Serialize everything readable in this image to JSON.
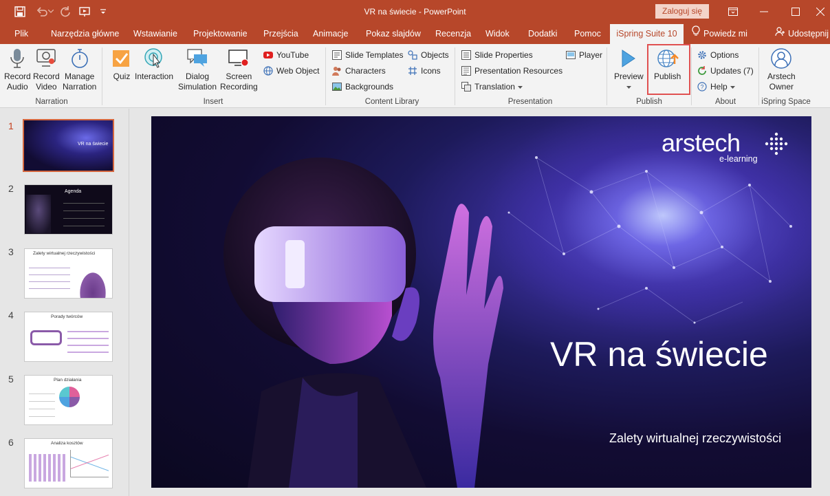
{
  "window": {
    "title": "VR na świecie  -  PowerPoint",
    "login_label": "Zaloguj się"
  },
  "tabs": [
    {
      "label": "Plik"
    },
    {
      "label": "Narzędzia główne"
    },
    {
      "label": "Wstawianie"
    },
    {
      "label": "Projektowanie"
    },
    {
      "label": "Przejścia"
    },
    {
      "label": "Animacje"
    },
    {
      "label": "Pokaz slajdów"
    },
    {
      "label": "Recenzja"
    },
    {
      "label": "Widok"
    },
    {
      "label": "Dodatki"
    },
    {
      "label": "Pomoc"
    },
    {
      "label": "iSpring Suite 10",
      "active": true
    }
  ],
  "tell_me": "Powiedz mi",
  "share": "Udostępnij",
  "ribbon": {
    "narration": {
      "group_label": "Narration",
      "record_audio": "Record\nAudio",
      "record_video": "Record\nVideo",
      "manage_narration": "Manage\nNarration"
    },
    "insert": {
      "group_label": "Insert",
      "quiz": "Quiz",
      "interaction": "Interaction",
      "dialog_simulation": "Dialog\nSimulation",
      "screen_recording": "Screen\nRecording",
      "youtube": "YouTube",
      "web_object": "Web Object"
    },
    "content_library": {
      "group_label": "Content Library",
      "slide_templates": "Slide Templates",
      "characters": "Characters",
      "backgrounds": "Backgrounds",
      "objects": "Objects",
      "icons": "Icons"
    },
    "presentation": {
      "group_label": "Presentation",
      "slide_properties": "Slide Properties",
      "presentation_resources": "Presentation Resources",
      "translation": "Translation",
      "player": "Player"
    },
    "publish": {
      "group_label": "Publish",
      "preview": "Preview",
      "publish": "Publish"
    },
    "about": {
      "group_label": "About",
      "options": "Options",
      "updates": "Updates (7)",
      "help": "Help"
    },
    "ispring_space": {
      "group_label": "iSpring Space",
      "owner": "Arstech\nOwner"
    }
  },
  "slides": [
    {
      "number": "1",
      "title": "VR na świecie",
      "active": true
    },
    {
      "number": "2",
      "title": "Agenda"
    },
    {
      "number": "3",
      "title": "Zalety wirtualnej rzeczywistości"
    },
    {
      "number": "4",
      "title": "Porady twórców"
    },
    {
      "number": "5",
      "title": "Plan działania"
    },
    {
      "number": "6",
      "title": "Analiza kosztów"
    }
  ],
  "current_slide": {
    "title": "VR na świecie",
    "subtitle": "Zalety wirtualnej rzeczywistości",
    "logo_main": "arstech",
    "logo_sub": "e-learning"
  },
  "colors": {
    "accent": "#b7472a",
    "highlight": "#e05050"
  }
}
